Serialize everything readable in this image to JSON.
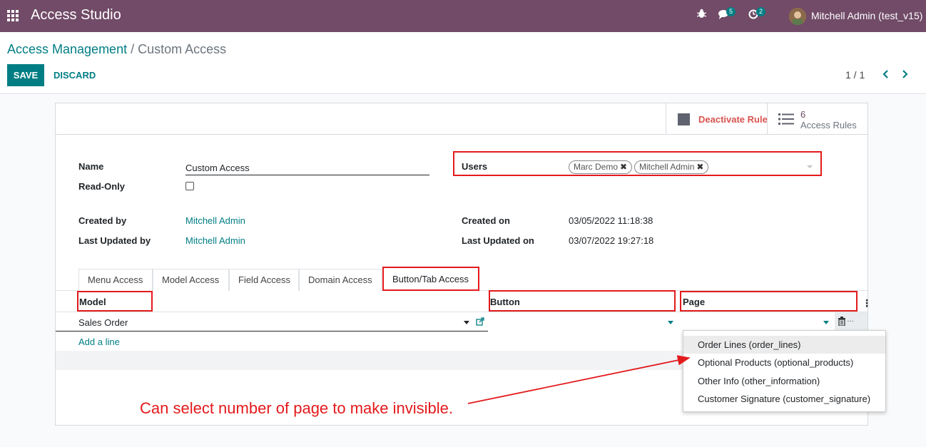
{
  "topbar": {
    "app_title": "Access Studio",
    "user_name": "Mitchell Admin (test_v15)",
    "messages_badge": "5",
    "activities_badge": "2",
    "icons": [
      "apps-icon",
      "bug-icon",
      "chat-icon",
      "clock-icon",
      "avatar"
    ]
  },
  "breadcrumb": {
    "parent": "Access Management",
    "separator": "/",
    "current": "Custom Access"
  },
  "actions": {
    "save": "SAVE",
    "discard": "DISCARD"
  },
  "pager": {
    "value": "1 / 1",
    "prev": "‹",
    "next": "›"
  },
  "button_box": {
    "deactivate": "Deactivate Rule",
    "rules_count": "6",
    "rules_label": "Access Rules"
  },
  "form": {
    "name_label": "Name",
    "name_value": "Custom Access",
    "readonly_label": "Read-Only",
    "readonly_checked": false,
    "users_label": "Users",
    "users": [
      {
        "name": "Marc Demo"
      },
      {
        "name": "Mitchell Admin"
      }
    ],
    "created_by_label": "Created by",
    "created_by": "Mitchell Admin",
    "last_updated_by_label": "Last Updated by",
    "last_updated_by": "Mitchell Admin",
    "created_on_label": "Created on",
    "created_on": "03/05/2022 11:18:38",
    "last_updated_on_label": "Last Updated on",
    "last_updated_on": "03/07/2022 19:27:18"
  },
  "tabs": [
    {
      "label": "Menu Access",
      "active": false
    },
    {
      "label": "Model Access",
      "active": false
    },
    {
      "label": "Field Access",
      "active": false
    },
    {
      "label": "Domain Access",
      "active": false
    },
    {
      "label": "Button/Tab Access",
      "active": true
    }
  ],
  "list": {
    "headers": {
      "model": "Model",
      "button": "Button",
      "page": "Page"
    },
    "rows": [
      {
        "model": "Sales Order",
        "button": "",
        "page": ""
      }
    ],
    "add_line": "Add a line"
  },
  "dropdown": {
    "options": [
      "Order Lines (order_lines)",
      "Optional Products (optional_products)",
      "Other Info (other_information)",
      "Customer Signature (customer_signature)"
    ],
    "highlighted_index": 0
  },
  "annotation": {
    "text": "Can select number of page to make invisible.",
    "color": "#e31a1c"
  },
  "colors": {
    "topbar": "#714B67",
    "primary": "#017e84",
    "danger": "#d9534f",
    "highlight_box": "#e31a1c"
  }
}
